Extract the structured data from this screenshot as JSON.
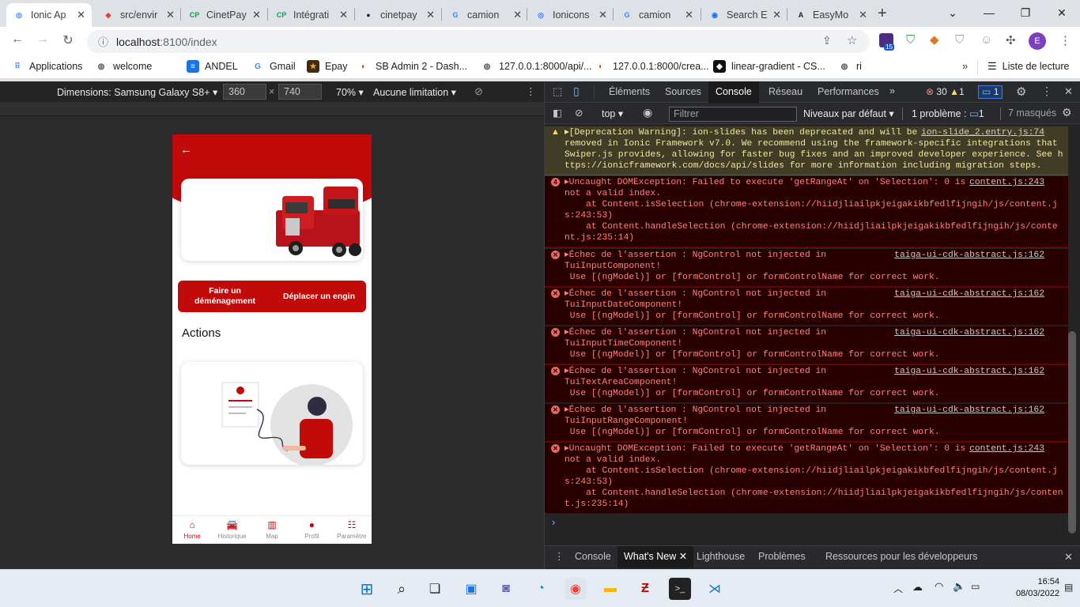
{
  "browser": {
    "tabs": [
      {
        "title": "Ionic Ap",
        "active": true,
        "icon": "ionic-icon"
      },
      {
        "title": "src/envir",
        "icon": "gitlab-icon"
      },
      {
        "title": "CinetPay",
        "icon": "cinetpay-icon"
      },
      {
        "title": "Intégrati",
        "icon": "cinetpay-icon"
      },
      {
        "title": "cinetpay",
        "icon": "github-icon"
      },
      {
        "title": "camion",
        "icon": "google-icon"
      },
      {
        "title": "Ionicons",
        "icon": "ionicons-icon"
      },
      {
        "title": "camion",
        "icon": "google-icon"
      },
      {
        "title": "Search E",
        "icon": "search-engine-icon"
      },
      {
        "title": "EasyMo",
        "icon": "easymo-icon"
      }
    ],
    "url_host": "localhost",
    "url_path": ":8100/index",
    "profile_initial": "E",
    "extension_badge": "15",
    "bookmarks": [
      {
        "label": "Applications",
        "icon": "apps-grid-icon"
      },
      {
        "label": "welcome",
        "icon": "globe-icon"
      },
      {
        "label": "ANDEL",
        "icon": "doc-icon"
      },
      {
        "label": "Gmail",
        "icon": "google-icon"
      },
      {
        "label": "Epay",
        "icon": "star-icon"
      },
      {
        "label": "SB Admin 2 - Dash...",
        "icon": "laravel-icon"
      },
      {
        "label": "127.0.0.1:8000/api/...",
        "icon": "globe-icon"
      },
      {
        "label": "127.0.0.1:8000/crea...",
        "icon": "laravel-icon"
      },
      {
        "label": "linear-gradient - CS...",
        "icon": "codepen-icon"
      },
      {
        "label": "ri",
        "icon": "globe-icon"
      }
    ],
    "reading_list": "Liste de lecture"
  },
  "device_toolbar": {
    "dimensions_label": "Dimensions: Samsung Galaxy S8+",
    "width": "360",
    "times": "×",
    "height": "740",
    "zoom": "70%",
    "throttle": "Aucune limitation"
  },
  "app": {
    "back_icon": "arrow-back-icon",
    "button_left": "Faire un déménagement",
    "button_right": "Déplacer un engin",
    "actions_title": "Actions",
    "tabs": [
      {
        "label": "Home",
        "icon": "home-icon"
      },
      {
        "label": "Historique",
        "icon": "car-icon"
      },
      {
        "label": "Map",
        "icon": "map-icon"
      },
      {
        "label": "Profil",
        "icon": "person-icon"
      },
      {
        "label": "Paramètre",
        "icon": "options-icon"
      }
    ]
  },
  "devtools": {
    "tabs": [
      "Éléments",
      "Sources",
      "Console",
      "Réseau",
      "Performances"
    ],
    "active_tab": "Console",
    "error_count": "30",
    "warning_count": "1",
    "info_count": "1",
    "context": "top",
    "filter_placeholder": "Filtrer",
    "levels": "Niveaux par défaut",
    "issues": "1 problème :",
    "issues_count": "1",
    "hidden": "7 masqués",
    "logs": [
      {
        "type": "warn",
        "marker": "▲",
        "lines": [
          "▸[Deprecation Warning]: ion-slides has been deprecated and will be",
          "removed in Ionic Framework v7.0. We recommend using the framework-specific integrations that",
          "Swiper.js provides, allowing for faster bug fixes and an improved developer experience. See h",
          "ttps://ionicframework.com/docs/api/slides for more information including migration steps."
        ],
        "source": "ion-slide_2.entry.js:74"
      },
      {
        "type": "err",
        "marker": "4",
        "lines": [
          "▸Uncaught DOMException: Failed to execute 'getRangeAt' on 'Selection': 0 is",
          "not a valid index.",
          "    at Content.isSelection (chrome-extension://hiidjliailpkjeigakikbfedlfijngih/js/content.j",
          "s:243:53)",
          "    at Content.handleSelection (chrome-extension://hiidjliailpkjeigakikbfedlfijngih/js/conte",
          "nt.js:235:14)"
        ],
        "source": "content.js:243"
      },
      {
        "type": "err",
        "marker": "✕",
        "lines": [
          "▸Échec de l'assertion : NgControl not injected in",
          "TuiInputComponent!",
          " Use [(ngModel)] or [formControl] or formControlName for correct work."
        ],
        "source": "taiga-ui-cdk-abstract.js:162"
      },
      {
        "type": "err",
        "marker": "✕",
        "lines": [
          "▸Échec de l'assertion : NgControl not injected in",
          "TuiInputDateComponent!",
          " Use [(ngModel)] or [formControl] or formControlName for correct work."
        ],
        "source": "taiga-ui-cdk-abstract.js:162"
      },
      {
        "type": "err",
        "marker": "✕",
        "lines": [
          "▸Échec de l'assertion : NgControl not injected in",
          "TuiInputTimeComponent!",
          " Use [(ngModel)] or [formControl] or formControlName for correct work."
        ],
        "source": "taiga-ui-cdk-abstract.js:162"
      },
      {
        "type": "err",
        "marker": "✕",
        "lines": [
          "▸Échec de l'assertion : NgControl not injected in",
          "TuiTextAreaComponent!",
          " Use [(ngModel)] or [formControl] or formControlName for correct work."
        ],
        "source": "taiga-ui-cdk-abstract.js:162"
      },
      {
        "type": "err",
        "marker": "✕",
        "lines": [
          "▸Échec de l'assertion : NgControl not injected in",
          "TuiInputRangeComponent!",
          " Use [(ngModel)] or [formControl] or formControlName for correct work."
        ],
        "source": "taiga-ui-cdk-abstract.js:162"
      },
      {
        "type": "err",
        "marker": "✕",
        "lines": [
          "▸Uncaught DOMException: Failed to execute 'getRangeAt' on 'Selection': 0 is",
          "not a valid index.",
          "    at Content.isSelection (chrome-extension://hiidjliailpkjeigakikbfedlfijngih/js/content.j",
          "s:243:53)",
          "    at Content.handleSelection (chrome-extension://hiidjliailpkjeigakikbfedlfijngih/js/conten",
          "t.js:235:14)"
        ],
        "source": "content.js:243"
      }
    ],
    "prompt": "›",
    "drawer_tabs": [
      "Console",
      "What's New",
      "Lighthouse",
      "Problèmes",
      "Ressources pour les développeurs"
    ],
    "drawer_active": "What's New"
  },
  "taskbar": {
    "time": "16:54",
    "date": "08/03/2022"
  }
}
